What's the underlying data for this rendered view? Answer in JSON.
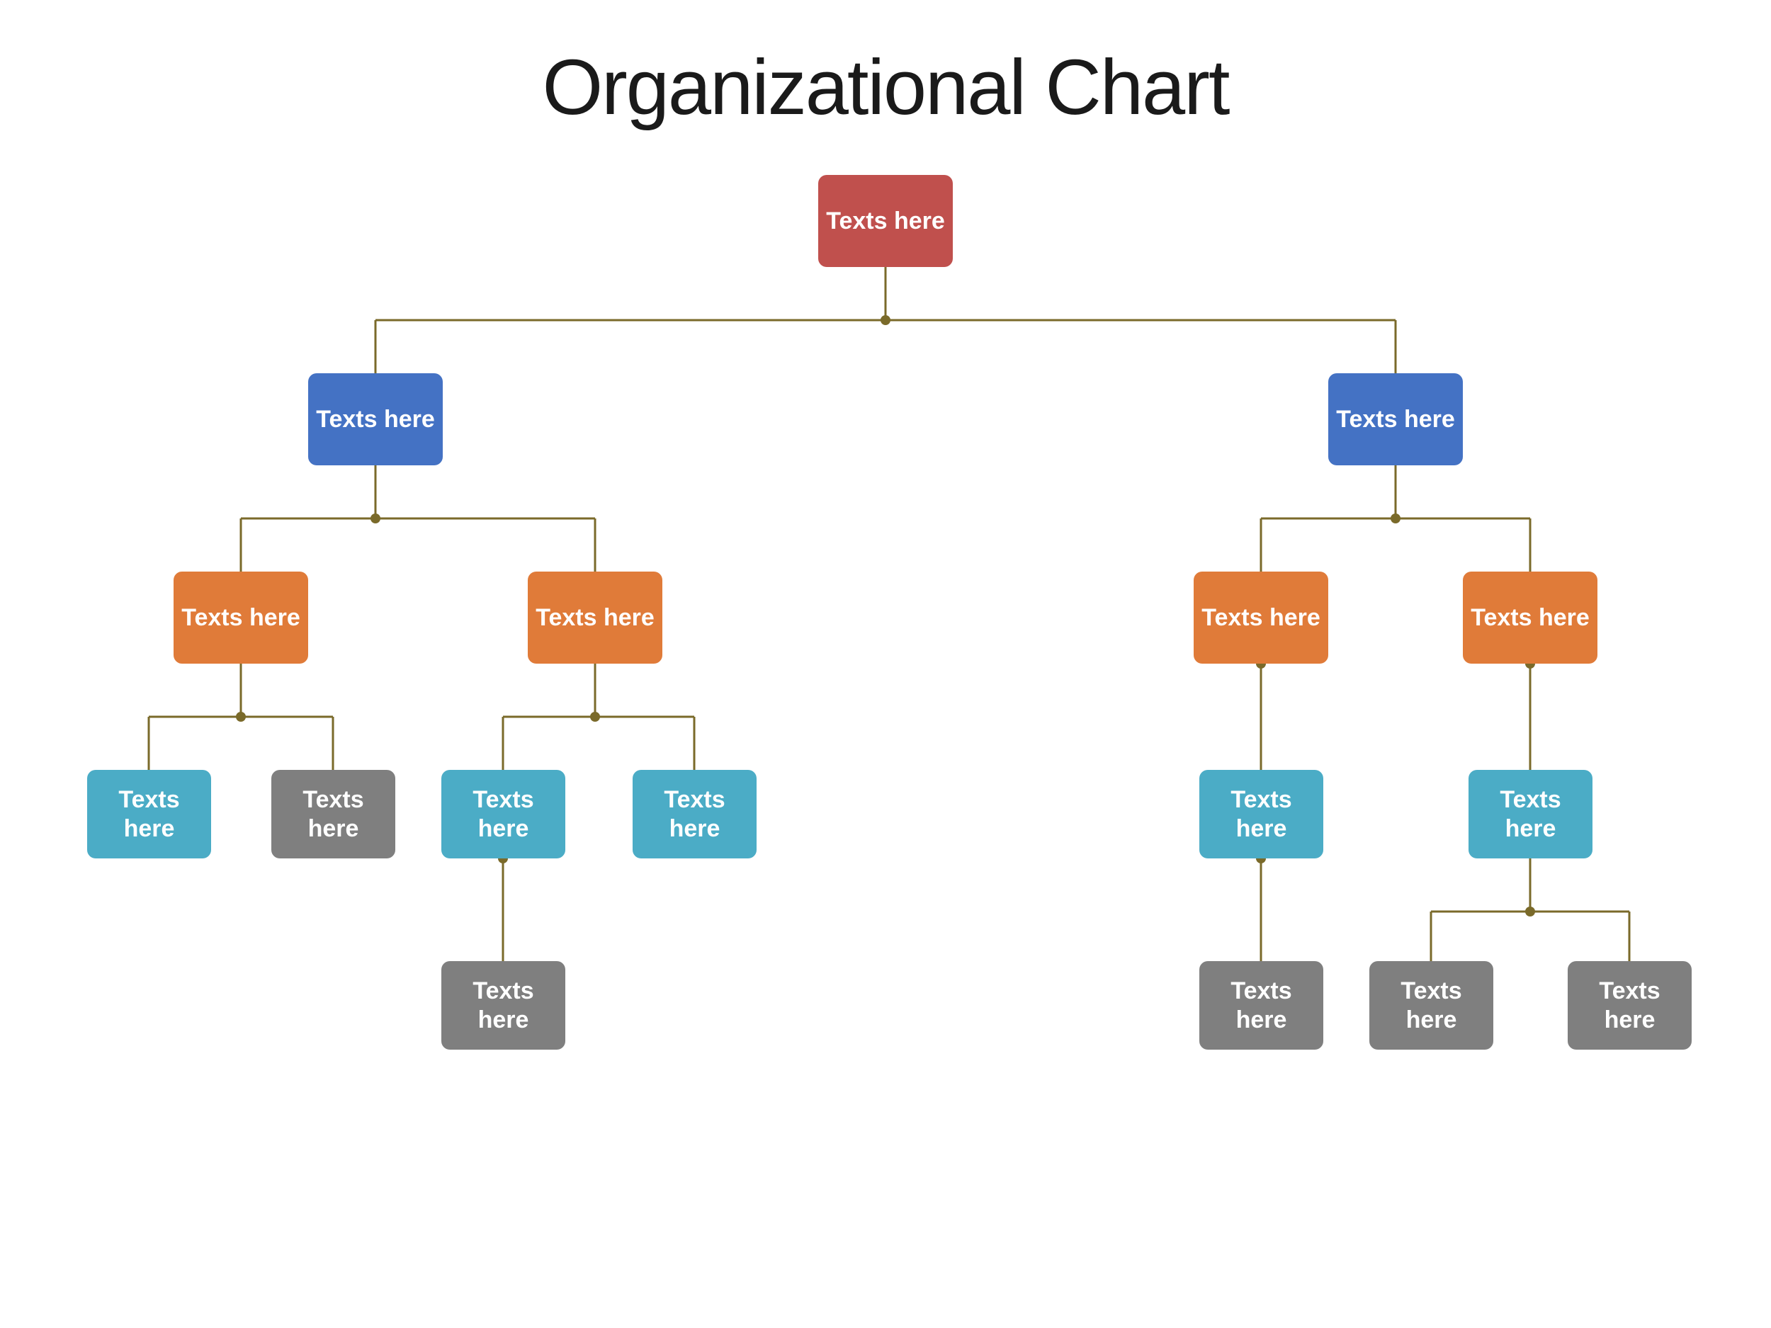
{
  "title": "Organizational Chart",
  "connector_color": "#7a6a2a",
  "nodes": {
    "root": {
      "label": "Texts here",
      "color": "red",
      "size": "lg"
    },
    "l1_left": {
      "label": "Texts here",
      "color": "blue",
      "size": "lg"
    },
    "l1_right": {
      "label": "Texts here",
      "color": "blue",
      "size": "lg"
    },
    "l2_ll": {
      "label": "Texts here",
      "color": "orange",
      "size": "md"
    },
    "l2_lr": {
      "label": "Texts here",
      "color": "orange",
      "size": "md"
    },
    "l2_rl": {
      "label": "Texts here",
      "color": "orange",
      "size": "md"
    },
    "l2_rr": {
      "label": "Texts here",
      "color": "orange",
      "size": "md"
    },
    "l3_lll": {
      "label": "Texts here",
      "color": "teal",
      "size": "sm"
    },
    "l3_llr": {
      "label": "Texts here",
      "color": "gray",
      "size": "sm"
    },
    "l3_lrl": {
      "label": "Texts here",
      "color": "teal",
      "size": "sm"
    },
    "l3_lrr": {
      "label": "Texts here",
      "color": "teal",
      "size": "sm"
    },
    "l3_rll": {
      "label": "Texts here",
      "color": "teal",
      "size": "sm"
    },
    "l3_rrl": {
      "label": "Texts here",
      "color": "teal",
      "size": "sm"
    },
    "l4_lrc": {
      "label": "Texts here",
      "color": "gray",
      "size": "sm"
    },
    "l4_rlc": {
      "label": "Texts here",
      "color": "gray",
      "size": "sm"
    },
    "l4_rrl": {
      "label": "Texts here",
      "color": "gray",
      "size": "sm"
    },
    "l4_rrr": {
      "label": "Texts here",
      "color": "gray",
      "size": "sm"
    }
  }
}
